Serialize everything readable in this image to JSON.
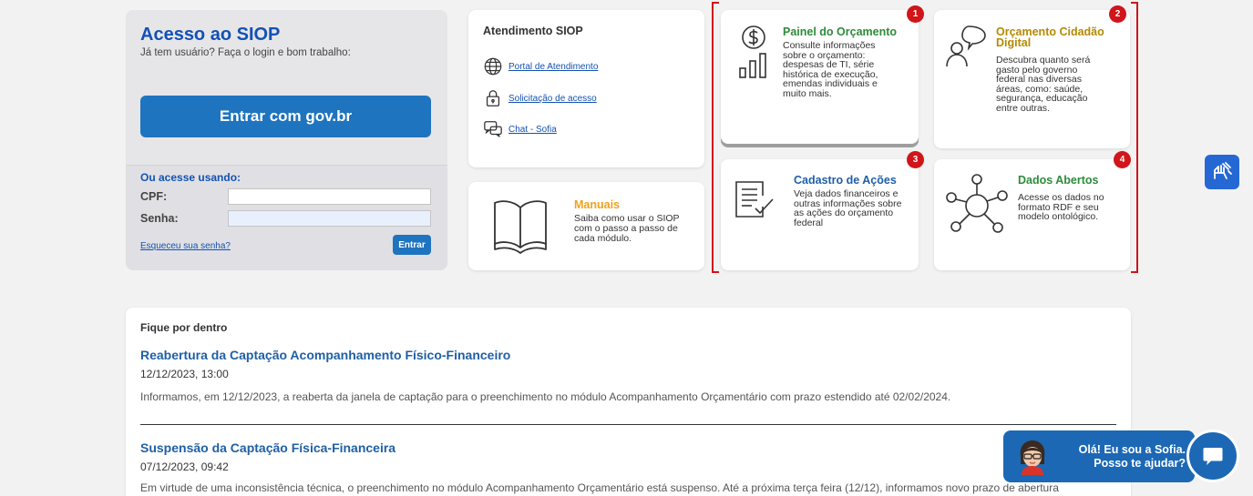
{
  "login": {
    "title": "Acesso ao SIOP",
    "subtitle": "Já tem usuário? Faça o login e bom trabalho:",
    "govbr_button": "Entrar com gov.br",
    "or_use": "Ou acesse usando:",
    "cpf_label": "CPF:",
    "cpf_value": "",
    "password_label": "Senha:",
    "password_value": "",
    "forgot": "Esqueceu sua senha?",
    "enter_button": "Entrar"
  },
  "atendimento": {
    "title": "Atendimento SIOP",
    "items": [
      {
        "label": "Portal de Atendimento",
        "icon": "globe-icon"
      },
      {
        "label": "Solicitação de acesso",
        "icon": "lock-icon"
      },
      {
        "label": "Chat - Sofia",
        "icon": "chat-icon"
      }
    ]
  },
  "manuais": {
    "title": "Manuais",
    "description": "Saiba como usar o SIOP com o passo a passo de cada módulo.",
    "icon": "book-icon"
  },
  "features": [
    {
      "badge": "1",
      "title": "Painel do Orçamento",
      "title_color": "#2e8b3a",
      "description": "Consulte informações sobre o orçamento: despesas de TI, série histórica de execução, emendas individuais e muito mais.",
      "icon": "budget-chart-icon"
    },
    {
      "badge": "2",
      "title": "Orçamento Cidadão Digital",
      "title_color": "#b58a00",
      "description": "Descubra quanto será gasto pelo governo federal nas diversas áreas, como: saúde, segurança, educação entre outras.",
      "icon": "person-speech-icon"
    },
    {
      "badge": "3",
      "title": "Cadastro de Ações",
      "title_color": "#1f5fa6",
      "description": "Veja dados financeiros e outras informações sobre as ações do orçamento federal",
      "icon": "document-check-icon"
    },
    {
      "badge": "4",
      "title": "Dados Abertos",
      "title_color": "#2e8b3a",
      "description": "Acesse os dados no formato RDF e seu modelo ontológico.",
      "icon": "network-icon"
    }
  ],
  "news": {
    "heading": "Fique por dentro",
    "items": [
      {
        "title": "Reabertura da Captação Acompanhamento Físico-Financeiro",
        "date": "12/12/2023, 13:00",
        "body": "Informamos, em 12/12/2023, a reaberta da janela de captação para o preenchimento no módulo Acompanhamento Orçamentário com prazo estendido até 02/02/2024."
      },
      {
        "title": "Suspensão da Captação Física-Financeira",
        "date": "07/12/2023, 09:42",
        "body": "Em virtude de uma inconsistência técnica, o preenchimento no módulo Acompanhamento Orçamentário está suspenso. Até a próxima terça feira (12/12), informamos novo prazo de abertura"
      }
    ]
  },
  "chat": {
    "line1": "Olá! Eu sou a Sofia.",
    "line2": "Posso te ajudar?"
  },
  "colors": {
    "primary": "#1f74bf",
    "highlight_red": "#d0151b",
    "manuais_orange": "#f0a21b"
  }
}
